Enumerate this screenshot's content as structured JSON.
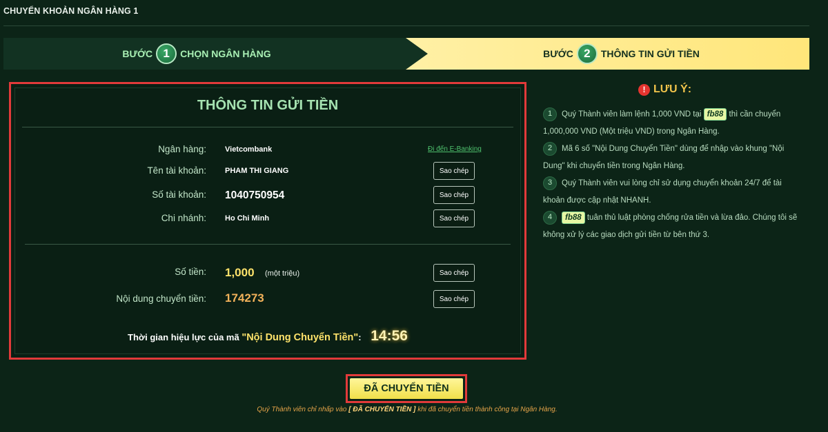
{
  "page": {
    "title": "CHUYỂN KHOẢN NGÂN HÀNG 1"
  },
  "steps": [
    {
      "word": "BƯỚC",
      "number": "1",
      "label": "CHỌN NGÂN HÀNG"
    },
    {
      "word": "BƯỚC",
      "number": "2",
      "label": "THÔNG TIN GỬI TIỀN"
    }
  ],
  "card": {
    "title": "THÔNG TIN GỬI TIỀN",
    "bank_label": "Ngân hàng:",
    "bank_value": "Vietcombank",
    "ebanking_link": "Đi đến E-Banking",
    "account_name_label": "Tên tài khoản:",
    "account_name_value": "PHAM THI GIANG",
    "account_number_label": "Số tài khoản:",
    "account_number_value": "1040750954",
    "branch_label": "Chi nhánh:",
    "branch_value": "Ho Chi Minh",
    "amount_label": "Số tiền:",
    "amount_value": "1,000",
    "amount_unit": "(một triệu)",
    "content_label": "Nội dung chuyển tiền:",
    "content_value": "174273",
    "copy_label": "Sao chép",
    "validity_text": "Thời gian hiệu lực của mã",
    "validity_quote": "\"Nội Dung Chuyển Tiền\"",
    "validity_colon": ":",
    "timer": "14:56"
  },
  "notes": {
    "icon": "exclamation-icon",
    "title": "LƯU Ý:",
    "brand": "fb88",
    "items": [
      {
        "num": "1",
        "before": "Quý Thành viên làm lệnh 1,000 VND tại",
        "after": "thì cần chuyển 1,000,000 VND (Một triệu VND) trong Ngân Hàng."
      },
      {
        "num": "2",
        "before": "Mã 6 số \"Nội Dung Chuyển Tiền\" dùng để nhập vào khung \"Nội Dung\" khi chuyển tiền trong Ngân Hàng.",
        "after": ""
      },
      {
        "num": "3",
        "before": "Quý Thành viên vui lòng chỉ sử dụng chuyển khoản 24/7 để tài khoản được cập nhật NHANH.",
        "after": ""
      },
      {
        "num": "4",
        "before": "",
        "after": "tuân thủ luật phòng chống rửa tiền và lừa đảo. Chúng tôi sẽ không xử lý các giao dịch gửi tiền từ bên thứ 3."
      }
    ]
  },
  "confirm": {
    "label": "ĐÃ CHUYỂN TIỀN",
    "footnote_before": "Quý Thành viên chỉ nhấp vào",
    "footnote_bold": "[ ĐÃ CHUYỂN TIỀN ]",
    "footnote_after": "khi đã chuyển tiền thành công tại Ngân Hàng."
  },
  "colors": {
    "background": "#0c2417",
    "accent_yellow": "#ffe36b",
    "highlight_red": "#e23a3a",
    "green_text": "#a6e3b1"
  }
}
